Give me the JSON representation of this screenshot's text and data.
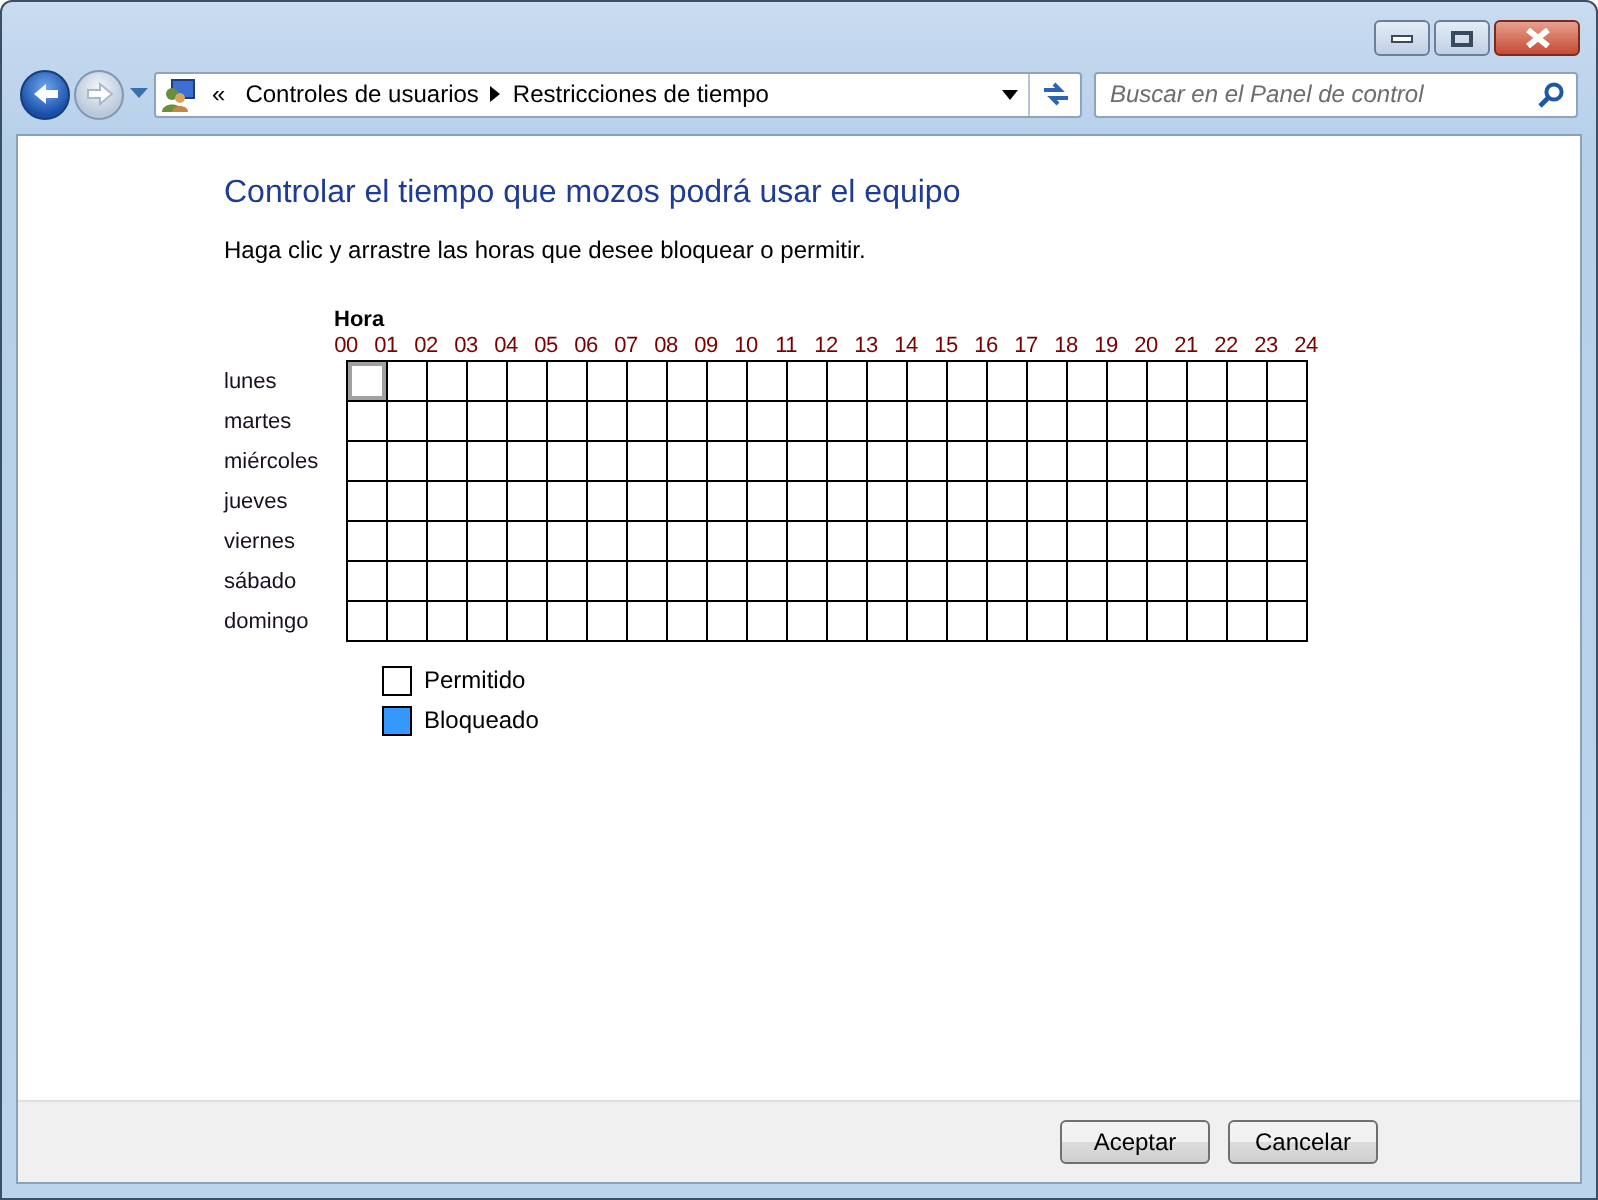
{
  "address_bar": {
    "overflow": "«",
    "breadcrumbs": [
      "Controles de usuarios",
      "Restricciones de tiempo"
    ]
  },
  "search": {
    "placeholder": "Buscar en el Panel de control"
  },
  "heading": "Controlar el tiempo que mozos podrá usar el equipo",
  "instructions": "Haga clic y arrastre las horas que desee bloquear o permitir.",
  "grid": {
    "axis_label": "Hora",
    "hours": [
      "00",
      "01",
      "02",
      "03",
      "04",
      "05",
      "06",
      "07",
      "08",
      "09",
      "10",
      "11",
      "12",
      "13",
      "14",
      "15",
      "16",
      "17",
      "18",
      "19",
      "20",
      "21",
      "22",
      "23",
      "24"
    ],
    "days": [
      {
        "label": "lunes",
        "cells": [
          {
            "blocked": false,
            "focused": true
          },
          {
            "blocked": false,
            "focused": false
          },
          {
            "blocked": false,
            "focused": false
          },
          {
            "blocked": false,
            "focused": false
          },
          {
            "blocked": false,
            "focused": false
          },
          {
            "blocked": false,
            "focused": false
          },
          {
            "blocked": false,
            "focused": false
          },
          {
            "blocked": false,
            "focused": false
          },
          {
            "blocked": false,
            "focused": false
          },
          {
            "blocked": false,
            "focused": false
          },
          {
            "blocked": false,
            "focused": false
          },
          {
            "blocked": false,
            "focused": false
          },
          {
            "blocked": false,
            "focused": false
          },
          {
            "blocked": false,
            "focused": false
          },
          {
            "blocked": false,
            "focused": false
          },
          {
            "blocked": false,
            "focused": false
          },
          {
            "blocked": false,
            "focused": false
          },
          {
            "blocked": false,
            "focused": false
          },
          {
            "blocked": false,
            "focused": false
          },
          {
            "blocked": false,
            "focused": false
          },
          {
            "blocked": false,
            "focused": false
          },
          {
            "blocked": false,
            "focused": false
          },
          {
            "blocked": false,
            "focused": false
          },
          {
            "blocked": false,
            "focused": false
          }
        ]
      },
      {
        "label": "martes",
        "cells": [
          {
            "blocked": false,
            "focused": false
          },
          {
            "blocked": false,
            "focused": false
          },
          {
            "blocked": false,
            "focused": false
          },
          {
            "blocked": false,
            "focused": false
          },
          {
            "blocked": false,
            "focused": false
          },
          {
            "blocked": false,
            "focused": false
          },
          {
            "blocked": false,
            "focused": false
          },
          {
            "blocked": false,
            "focused": false
          },
          {
            "blocked": false,
            "focused": false
          },
          {
            "blocked": false,
            "focused": false
          },
          {
            "blocked": false,
            "focused": false
          },
          {
            "blocked": false,
            "focused": false
          },
          {
            "blocked": false,
            "focused": false
          },
          {
            "blocked": false,
            "focused": false
          },
          {
            "blocked": false,
            "focused": false
          },
          {
            "blocked": false,
            "focused": false
          },
          {
            "blocked": false,
            "focused": false
          },
          {
            "blocked": false,
            "focused": false
          },
          {
            "blocked": false,
            "focused": false
          },
          {
            "blocked": false,
            "focused": false
          },
          {
            "blocked": false,
            "focused": false
          },
          {
            "blocked": false,
            "focused": false
          },
          {
            "blocked": false,
            "focused": false
          },
          {
            "blocked": false,
            "focused": false
          }
        ]
      },
      {
        "label": "miércoles",
        "cells": [
          {
            "blocked": false,
            "focused": false
          },
          {
            "blocked": false,
            "focused": false
          },
          {
            "blocked": false,
            "focused": false
          },
          {
            "blocked": false,
            "focused": false
          },
          {
            "blocked": false,
            "focused": false
          },
          {
            "blocked": false,
            "focused": false
          },
          {
            "blocked": false,
            "focused": false
          },
          {
            "blocked": false,
            "focused": false
          },
          {
            "blocked": false,
            "focused": false
          },
          {
            "blocked": false,
            "focused": false
          },
          {
            "blocked": false,
            "focused": false
          },
          {
            "blocked": false,
            "focused": false
          },
          {
            "blocked": false,
            "focused": false
          },
          {
            "blocked": false,
            "focused": false
          },
          {
            "blocked": false,
            "focused": false
          },
          {
            "blocked": false,
            "focused": false
          },
          {
            "blocked": false,
            "focused": false
          },
          {
            "blocked": false,
            "focused": false
          },
          {
            "blocked": false,
            "focused": false
          },
          {
            "blocked": false,
            "focused": false
          },
          {
            "blocked": false,
            "focused": false
          },
          {
            "blocked": false,
            "focused": false
          },
          {
            "blocked": false,
            "focused": false
          },
          {
            "blocked": false,
            "focused": false
          }
        ]
      },
      {
        "label": "jueves",
        "cells": [
          {
            "blocked": false,
            "focused": false
          },
          {
            "blocked": false,
            "focused": false
          },
          {
            "blocked": false,
            "focused": false
          },
          {
            "blocked": false,
            "focused": false
          },
          {
            "blocked": false,
            "focused": false
          },
          {
            "blocked": false,
            "focused": false
          },
          {
            "blocked": false,
            "focused": false
          },
          {
            "blocked": false,
            "focused": false
          },
          {
            "blocked": false,
            "focused": false
          },
          {
            "blocked": false,
            "focused": false
          },
          {
            "blocked": false,
            "focused": false
          },
          {
            "blocked": false,
            "focused": false
          },
          {
            "blocked": false,
            "focused": false
          },
          {
            "blocked": false,
            "focused": false
          },
          {
            "blocked": false,
            "focused": false
          },
          {
            "blocked": false,
            "focused": false
          },
          {
            "blocked": false,
            "focused": false
          },
          {
            "blocked": false,
            "focused": false
          },
          {
            "blocked": false,
            "focused": false
          },
          {
            "blocked": false,
            "focused": false
          },
          {
            "blocked": false,
            "focused": false
          },
          {
            "blocked": false,
            "focused": false
          },
          {
            "blocked": false,
            "focused": false
          },
          {
            "blocked": false,
            "focused": false
          }
        ]
      },
      {
        "label": "viernes",
        "cells": [
          {
            "blocked": false,
            "focused": false
          },
          {
            "blocked": false,
            "focused": false
          },
          {
            "blocked": false,
            "focused": false
          },
          {
            "blocked": false,
            "focused": false
          },
          {
            "blocked": false,
            "focused": false
          },
          {
            "blocked": false,
            "focused": false
          },
          {
            "blocked": false,
            "focused": false
          },
          {
            "blocked": false,
            "focused": false
          },
          {
            "blocked": false,
            "focused": false
          },
          {
            "blocked": false,
            "focused": false
          },
          {
            "blocked": false,
            "focused": false
          },
          {
            "blocked": false,
            "focused": false
          },
          {
            "blocked": false,
            "focused": false
          },
          {
            "blocked": false,
            "focused": false
          },
          {
            "blocked": false,
            "focused": false
          },
          {
            "blocked": false,
            "focused": false
          },
          {
            "blocked": false,
            "focused": false
          },
          {
            "blocked": false,
            "focused": false
          },
          {
            "blocked": false,
            "focused": false
          },
          {
            "blocked": false,
            "focused": false
          },
          {
            "blocked": false,
            "focused": false
          },
          {
            "blocked": false,
            "focused": false
          },
          {
            "blocked": false,
            "focused": false
          },
          {
            "blocked": false,
            "focused": false
          }
        ]
      },
      {
        "label": "sábado",
        "cells": [
          {
            "blocked": false,
            "focused": false
          },
          {
            "blocked": false,
            "focused": false
          },
          {
            "blocked": false,
            "focused": false
          },
          {
            "blocked": false,
            "focused": false
          },
          {
            "blocked": false,
            "focused": false
          },
          {
            "blocked": false,
            "focused": false
          },
          {
            "blocked": false,
            "focused": false
          },
          {
            "blocked": false,
            "focused": false
          },
          {
            "blocked": false,
            "focused": false
          },
          {
            "blocked": false,
            "focused": false
          },
          {
            "blocked": false,
            "focused": false
          },
          {
            "blocked": false,
            "focused": false
          },
          {
            "blocked": false,
            "focused": false
          },
          {
            "blocked": false,
            "focused": false
          },
          {
            "blocked": false,
            "focused": false
          },
          {
            "blocked": false,
            "focused": false
          },
          {
            "blocked": false,
            "focused": false
          },
          {
            "blocked": false,
            "focused": false
          },
          {
            "blocked": false,
            "focused": false
          },
          {
            "blocked": false,
            "focused": false
          },
          {
            "blocked": false,
            "focused": false
          },
          {
            "blocked": false,
            "focused": false
          },
          {
            "blocked": false,
            "focused": false
          },
          {
            "blocked": false,
            "focused": false
          }
        ]
      },
      {
        "label": "domingo",
        "cells": [
          {
            "blocked": false,
            "focused": false
          },
          {
            "blocked": false,
            "focused": false
          },
          {
            "blocked": false,
            "focused": false
          },
          {
            "blocked": false,
            "focused": false
          },
          {
            "blocked": false,
            "focused": false
          },
          {
            "blocked": false,
            "focused": false
          },
          {
            "blocked": false,
            "focused": false
          },
          {
            "blocked": false,
            "focused": false
          },
          {
            "blocked": false,
            "focused": false
          },
          {
            "blocked": false,
            "focused": false
          },
          {
            "blocked": false,
            "focused": false
          },
          {
            "blocked": false,
            "focused": false
          },
          {
            "blocked": false,
            "focused": false
          },
          {
            "blocked": false,
            "focused": false
          },
          {
            "blocked": false,
            "focused": false
          },
          {
            "blocked": false,
            "focused": false
          },
          {
            "blocked": false,
            "focused": false
          },
          {
            "blocked": false,
            "focused": false
          },
          {
            "blocked": false,
            "focused": false
          },
          {
            "blocked": false,
            "focused": false
          },
          {
            "blocked": false,
            "focused": false
          },
          {
            "blocked": false,
            "focused": false
          },
          {
            "blocked": false,
            "focused": false
          },
          {
            "blocked": false,
            "focused": false
          }
        ]
      }
    ]
  },
  "legend": [
    {
      "label": "Permitido",
      "color": "#ffffff"
    },
    {
      "label": "Bloqueado",
      "color": "#3399ff"
    }
  ],
  "buttons": [
    "Aceptar",
    "Cancelar"
  ]
}
